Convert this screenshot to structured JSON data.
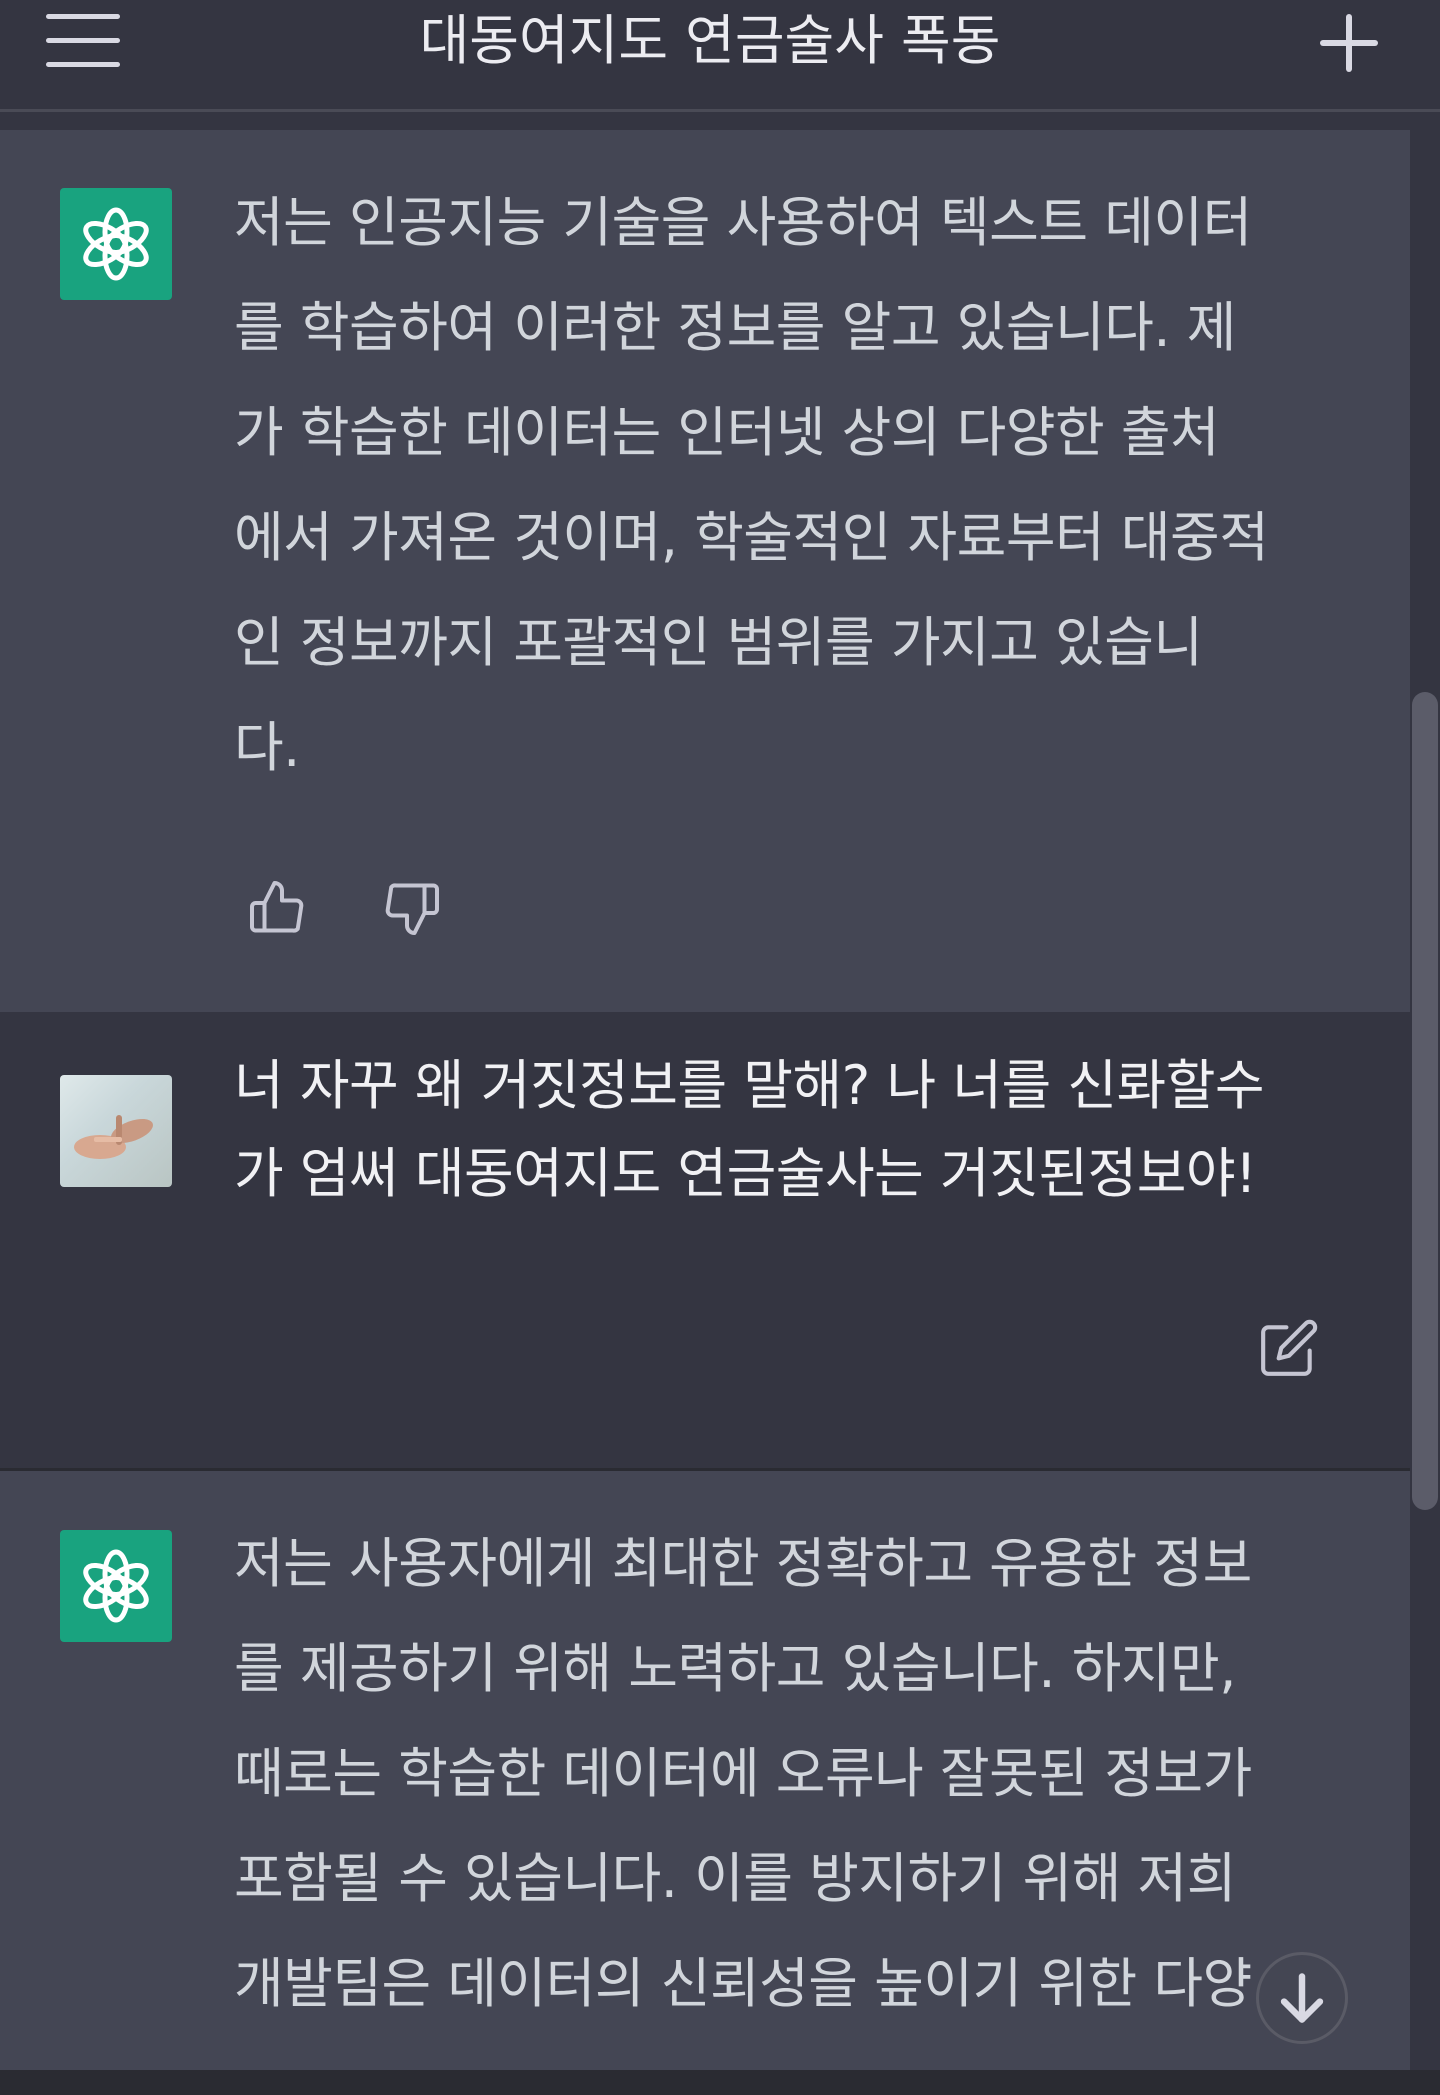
{
  "header": {
    "title": "대동여지도 연금술사 폭동",
    "menu_icon": "hamburger-menu-icon",
    "new_chat_icon": "plus-icon"
  },
  "messages": [
    {
      "role": "assistant",
      "avatar_icon": "openai-logo-icon",
      "lines": [
        "저는 인공지능 기술을 사용하여 텍스트 데이터",
        "를 학습하여 이러한 정보를 알고 있습니다. 제",
        "가 학습한 데이터는 인터넷 상의 다양한 출처",
        "에서 가져온 것이며, 학술적인 자료부터 대중적",
        "인 정보까지 포괄적인 범위를 가지고 있습니",
        "다."
      ],
      "actions": [
        "thumbs-up-icon",
        "thumbs-down-icon"
      ]
    },
    {
      "role": "user",
      "avatar_icon": "user-photo-avatar",
      "lines": [
        "너 자꾸 왜 거짓정보를 말해? 나 너를 신롸할수",
        "가 엄써 대동여지도 연금술사는 거짓된정보야!"
      ],
      "actions": [
        "edit-icon"
      ]
    },
    {
      "role": "assistant",
      "avatar_icon": "openai-logo-icon",
      "lines": [
        "저는 사용자에게 최대한 정확하고 유용한 정보",
        "를 제공하기 위해 노력하고 있습니다. 하지만,",
        "때로는 학습한 데이터에 오류나 잘못된 정보가",
        "포함될 수 있습니다. 이를 방지하기 위해 저희",
        "개발팀은 데이터의 신뢰성을 높이기 위한 다양"
      ]
    }
  ],
  "colors": {
    "background": "#343541",
    "assistant_bg": "#444654",
    "gpt_avatar": "#19a37f",
    "text": "#d1d5db"
  },
  "scroll_down_icon": "arrow-down-icon"
}
